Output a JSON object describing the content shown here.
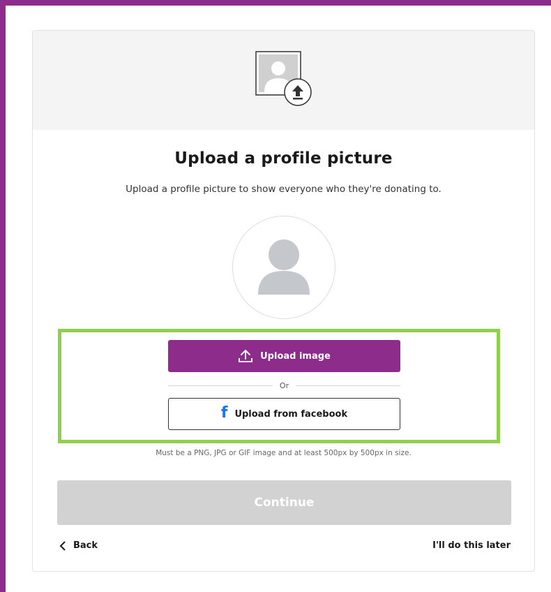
{
  "page": {
    "title": "Upload a profile picture",
    "subtitle": "Upload a profile picture to show everyone who they're donating to."
  },
  "upload": {
    "upload_button_label": "Upload image",
    "upload_icon": "upload-icon",
    "divider_text": "Or",
    "facebook_button_label": "Upload from facebook",
    "facebook_icon": "facebook-icon",
    "requirements_text": "Must be a PNG, JPG or GIF image and at least 500px by 500px in size."
  },
  "footer": {
    "continue_label": "Continue",
    "back_label": "Back",
    "later_label": "I'll do this later"
  },
  "colors": {
    "brand_purple": "#8e2c8c",
    "highlight_green": "#8fd14f",
    "disabled_gray": "#d2d2d2",
    "facebook_blue": "#1877f2"
  }
}
